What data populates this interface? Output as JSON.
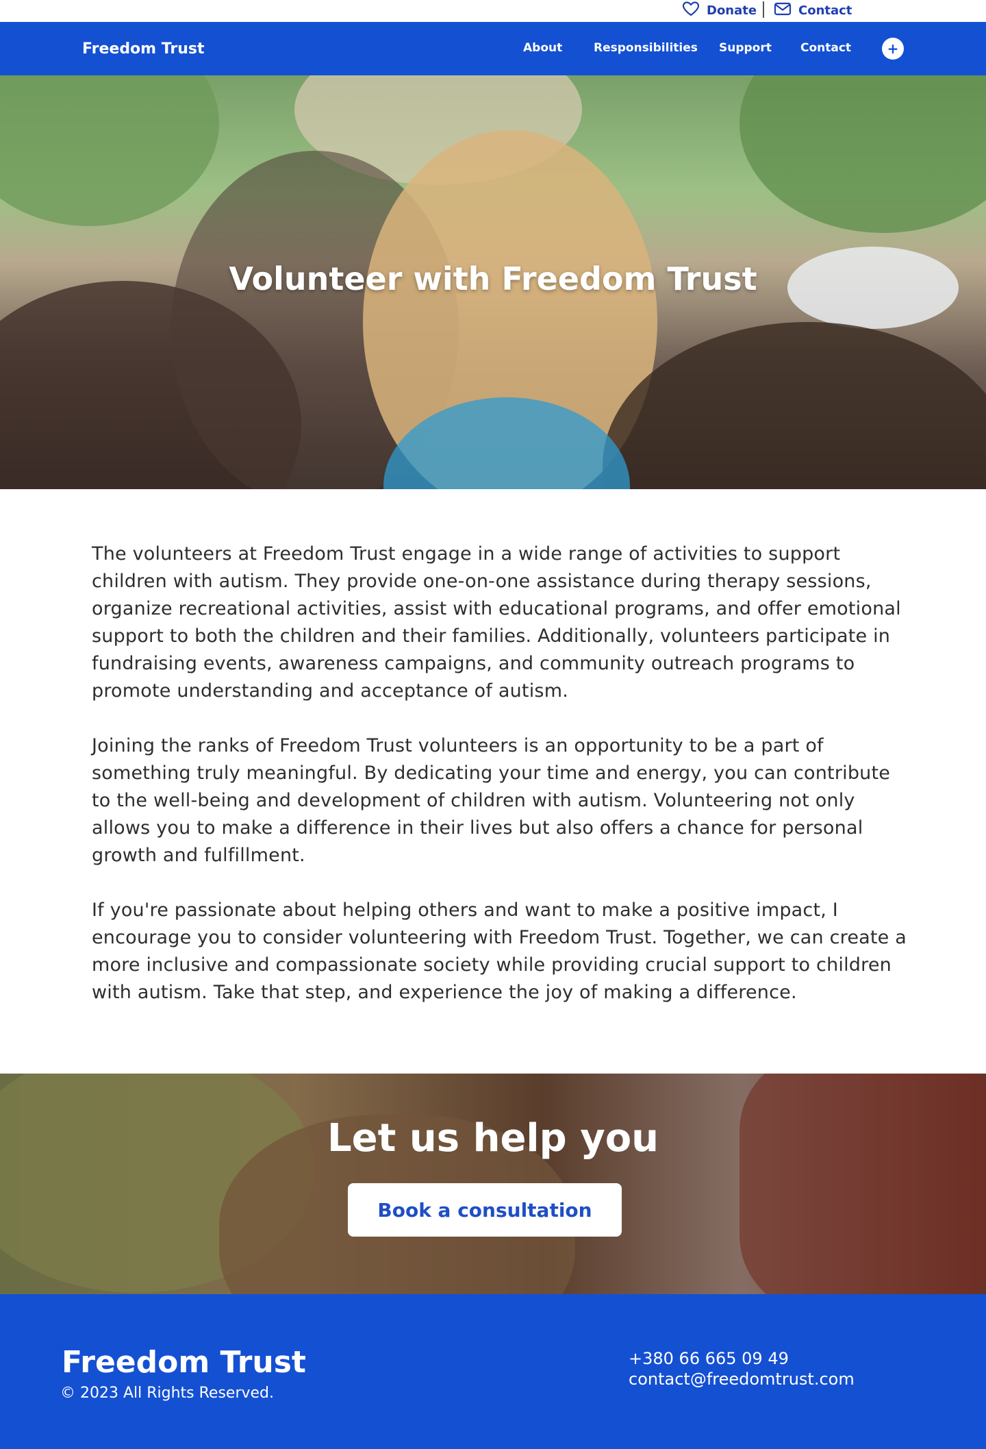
{
  "topbar": {
    "donate_label": "Donate",
    "contact_label": "Contact"
  },
  "nav": {
    "brand": "Freedom Trust",
    "items": [
      {
        "label": "About"
      },
      {
        "label": "Responsibilities"
      },
      {
        "label": "Support"
      },
      {
        "label": "Contact"
      }
    ],
    "plus_symbol": "+"
  },
  "hero": {
    "title": "Volunteer with Freedom Trust"
  },
  "content": {
    "paragraphs": [
      "The volunteers at Freedom Trust engage in a wide range of activities to support children with autism. They provide one-on-one assistance during therapy sessions, organize recreational activities, assist with educational programs, and offer emotional support to both the children and their families. Additionally, volunteers participate in fundraising events, awareness campaigns, and community outreach programs to promote understanding and acceptance of autism.",
      "Joining the ranks of Freedom Trust volunteers is an opportunity to be a part of something truly meaningful. By dedicating your time and energy, you can contribute to the well-being and development of children with autism. Volunteering not only allows you to make a difference in their lives but also offers a chance for personal growth and fulfillment.",
      "If you're passionate about helping others and want to make a positive impact, I encourage you to consider volunteering with Freedom Trust. Together, we can create a more inclusive and compassionate society while providing crucial support to children with autism. Take that step, and experience the joy of making a difference."
    ]
  },
  "cta": {
    "heading": "Let us help you",
    "button_label": "Book a consultation"
  },
  "footer": {
    "brand": "Freedom Trust",
    "copyright": "© 2023 All Rights Reserved.",
    "phone": "+380 66 665 09 49",
    "email": "contact@freedomtrust.com"
  },
  "colors": {
    "brand_blue": "#1450d2",
    "link_blue": "#1f3fb0",
    "white": "#ffffff"
  },
  "icons": {
    "donate": "heart-icon",
    "contact": "mail-icon",
    "plus": "plus-icon"
  }
}
